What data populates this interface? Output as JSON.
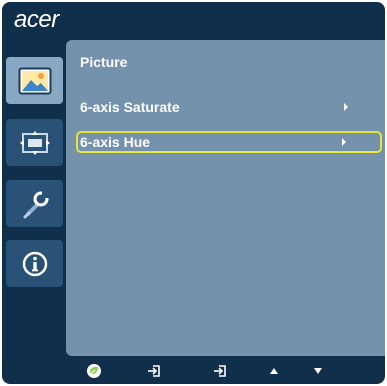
{
  "brand": {
    "logo_text": "acer"
  },
  "sidebar": {
    "items": [
      {
        "name": "picture",
        "icon": "picture-icon",
        "active": true
      },
      {
        "name": "display",
        "icon": "display-position-icon",
        "active": false
      },
      {
        "name": "settings",
        "icon": "wrench-icon",
        "active": false
      },
      {
        "name": "information",
        "icon": "info-icon",
        "active": false
      }
    ]
  },
  "main": {
    "title": "Picture",
    "items": [
      {
        "label": "6-axis Saturate",
        "selected": false
      },
      {
        "label": "6-axis Hue",
        "selected": true
      }
    ]
  },
  "bottom_bar": {
    "keys": [
      "eco-icon",
      "enter-icon",
      "enter-icon",
      "up-arrow-icon",
      "down-arrow-icon"
    ]
  },
  "colors": {
    "background": "#102f4b",
    "panel": "#7592ad",
    "sidebar_active": "#88a7c3",
    "sidebar_inactive": "#2a5276",
    "highlight": "#e6e63a",
    "eco_green": "#8fd14f"
  }
}
